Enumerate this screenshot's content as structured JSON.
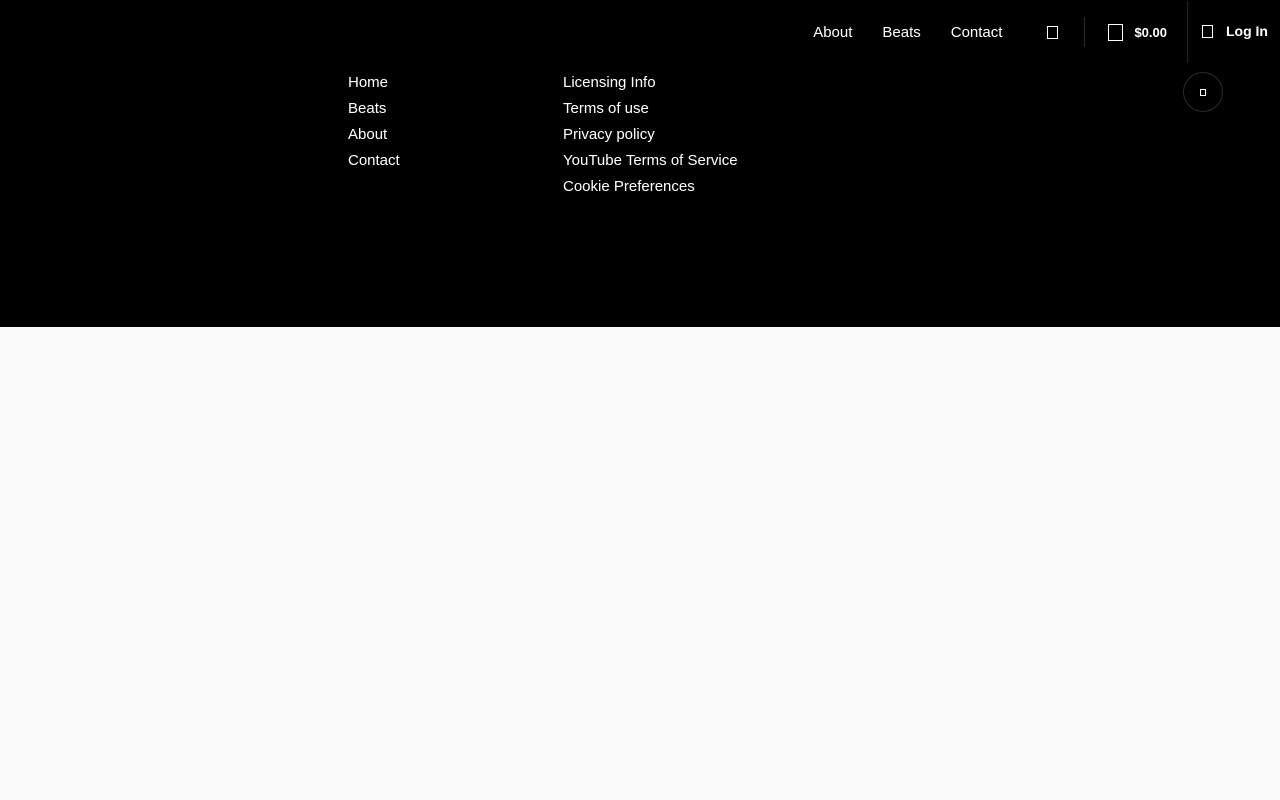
{
  "colors": {
    "header_bg": "#000000",
    "body_bg": "#fafafa",
    "text": "#ffffff"
  },
  "top_nav": {
    "links": [
      "About",
      "Beats",
      "Contact"
    ],
    "search_icon": "search-icon",
    "cart": {
      "icon": "cart-icon",
      "total": "$0.00"
    },
    "login": {
      "icon": "user-icon",
      "label": "Log In"
    }
  },
  "menu": {
    "column_1": [
      "Home",
      "Beats",
      "About",
      "Contact"
    ],
    "column_2": [
      "Licensing Info",
      "Terms of use",
      "Privacy policy",
      "YouTube Terms of Service",
      "Cookie Preferences"
    ]
  },
  "floating_button": {
    "icon": "close-icon"
  }
}
